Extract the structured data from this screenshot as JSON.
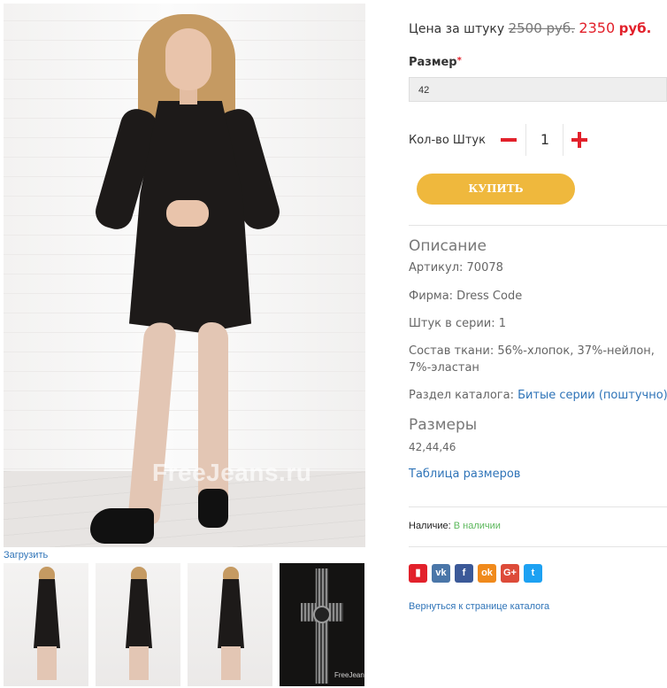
{
  "gallery": {
    "watermark": "FreeJeans.ru",
    "upload_label": "Загрузить",
    "thumb_watermark": "FreeJeans.ru"
  },
  "product": {
    "price_label": "Цена за штуку",
    "price_old": "2500 руб.",
    "price_new": "2350",
    "currency": "руб.",
    "size_label": "Размер",
    "required_mark": "*",
    "size_selected": "42",
    "qty_label": "Кол-во Штук",
    "qty_value": "1",
    "buy_label": "КУПИТЬ"
  },
  "description": {
    "heading": "Описание",
    "article": "Артикул: 70078",
    "brand": "Фирма: Dress Code",
    "series_count": "Штук в серии: 1",
    "fabric": "Состав ткани: 56%-хлопок, 37%-нейлон, 7%-эластан",
    "catalog_label": "Раздел каталога: ",
    "catalog_link": "Битые серии (поштучно)"
  },
  "sizes": {
    "heading": "Размеры",
    "values": "42,44,46",
    "table_link": "Таблица размеров"
  },
  "availability": {
    "label": "Наличие: ",
    "value": "В наличии"
  },
  "share": [
    {
      "name": "bookmark-icon",
      "glyph": "▮",
      "color": "#e2212b"
    },
    {
      "name": "vk-icon",
      "glyph": "vk",
      "color": "#4a76a8"
    },
    {
      "name": "facebook-icon",
      "glyph": "f",
      "color": "#3b5998"
    },
    {
      "name": "odnoklassniki-icon",
      "glyph": "ok",
      "color": "#f08a1c"
    },
    {
      "name": "google-plus-icon",
      "glyph": "G+",
      "color": "#dd4b39"
    },
    {
      "name": "twitter-icon",
      "glyph": "t",
      "color": "#1da1f2"
    }
  ],
  "back_link": "Вернуться к странице каталога",
  "colors": {
    "accent_red": "#e2212b",
    "buy_button": "#efb83d",
    "link_blue": "#2f74b8",
    "in_stock_green": "#5cb85c"
  }
}
